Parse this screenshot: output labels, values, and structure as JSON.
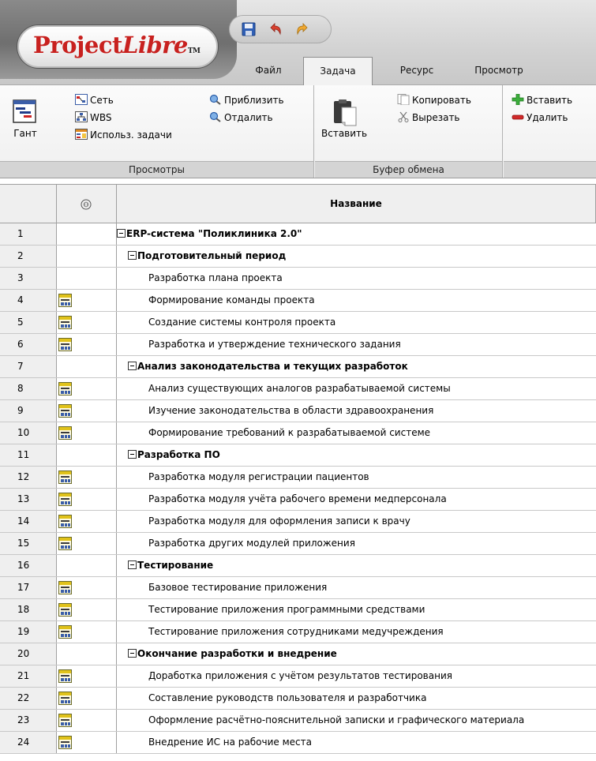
{
  "app": {
    "logo_main": "Project",
    "logo_italic": "Libre",
    "logo_tm": "TM"
  },
  "quick_access": {
    "save": "save-icon",
    "undo": "undo-icon",
    "redo": "redo-icon"
  },
  "tabs": [
    {
      "label": "Файл",
      "active": false
    },
    {
      "label": "Задача",
      "active": true
    },
    {
      "label": "Ресурс",
      "active": false
    },
    {
      "label": "Просмотр",
      "active": false
    }
  ],
  "ribbon": {
    "views": {
      "label": "Просмотры",
      "gantt": "Гант",
      "network": "Сеть",
      "wbs": "WBS",
      "task_usage": "Использ. задачи",
      "zoom_in": "Приблизить",
      "zoom_out": "Отдалить"
    },
    "clipboard": {
      "label": "Буфер обмена",
      "paste": "Вставить",
      "copy": "Копировать",
      "cut": "Вырезать"
    },
    "tasks": {
      "insert": "Вставить",
      "delete": "Удалить"
    }
  },
  "grid": {
    "column_title": "Название",
    "rows": [
      {
        "id": "1",
        "level": 0,
        "summary": true,
        "icon": false,
        "name": "ERP-система \"Поликлиника 2.0\""
      },
      {
        "id": "2",
        "level": 1,
        "summary": true,
        "icon": false,
        "name": "Подготовительный период"
      },
      {
        "id": "3",
        "level": 2,
        "summary": false,
        "icon": false,
        "name": "Разработка плана проекта"
      },
      {
        "id": "4",
        "level": 2,
        "summary": false,
        "icon": true,
        "name": "Формирование команды проекта"
      },
      {
        "id": "5",
        "level": 2,
        "summary": false,
        "icon": true,
        "name": "Создание системы контроля проекта"
      },
      {
        "id": "6",
        "level": 2,
        "summary": false,
        "icon": true,
        "name": "Разработка и утверждение технического задания"
      },
      {
        "id": "7",
        "level": 1,
        "summary": true,
        "icon": false,
        "name": "Анализ законодательства и текущих разработок"
      },
      {
        "id": "8",
        "level": 2,
        "summary": false,
        "icon": true,
        "name": "Анализ существующих аналогов разрабатываемой системы"
      },
      {
        "id": "9",
        "level": 2,
        "summary": false,
        "icon": true,
        "name": "Изучение законодательства в области здравоохранения"
      },
      {
        "id": "10",
        "level": 2,
        "summary": false,
        "icon": true,
        "name": "Формирование требований к разрабатываемой системе"
      },
      {
        "id": "11",
        "level": 1,
        "summary": true,
        "icon": false,
        "name": "Разработка ПО"
      },
      {
        "id": "12",
        "level": 2,
        "summary": false,
        "icon": true,
        "name": "Разработка модуля регистрации пациентов"
      },
      {
        "id": "13",
        "level": 2,
        "summary": false,
        "icon": true,
        "name": "Разработка модуля учёта рабочего времени медперсонала"
      },
      {
        "id": "14",
        "level": 2,
        "summary": false,
        "icon": true,
        "name": "Разработка модуля для оформления записи к врачу"
      },
      {
        "id": "15",
        "level": 2,
        "summary": false,
        "icon": true,
        "name": "Разработка других модулей приложения"
      },
      {
        "id": "16",
        "level": 1,
        "summary": true,
        "icon": false,
        "name": "Тестирование"
      },
      {
        "id": "17",
        "level": 2,
        "summary": false,
        "icon": true,
        "name": "Базовое тестирование приложения"
      },
      {
        "id": "18",
        "level": 2,
        "summary": false,
        "icon": true,
        "name": "Тестирование приложения программными средствами"
      },
      {
        "id": "19",
        "level": 2,
        "summary": false,
        "icon": true,
        "name": "Тестирование приложения сотрудниками медучреждения"
      },
      {
        "id": "20",
        "level": 1,
        "summary": true,
        "icon": false,
        "name": "Окончание разработки и внедрение"
      },
      {
        "id": "21",
        "level": 2,
        "summary": false,
        "icon": true,
        "name": "Доработка приложения с учётом результатов тестирования"
      },
      {
        "id": "22",
        "level": 2,
        "summary": false,
        "icon": true,
        "name": "Составление руководств пользователя и разработчика"
      },
      {
        "id": "23",
        "level": 2,
        "summary": false,
        "icon": true,
        "name": "Оформление расчётно-пояснительной записки и графического материала"
      },
      {
        "id": "24",
        "level": 2,
        "summary": false,
        "icon": true,
        "name": "Внедрение ИС на рабочие места"
      }
    ]
  }
}
